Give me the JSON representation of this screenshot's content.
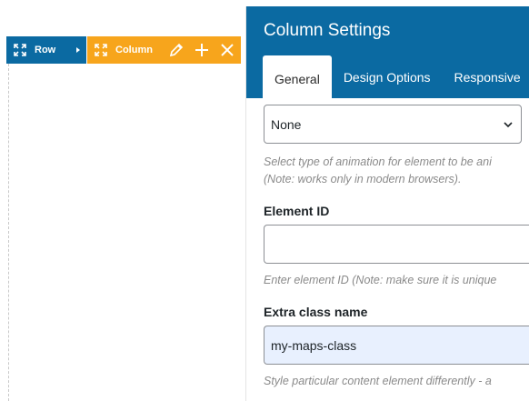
{
  "builder": {
    "row_label": "Row",
    "column_label": "Column"
  },
  "panel": {
    "title": "Column Settings",
    "tabs": [
      "General",
      "Design Options",
      "Responsive"
    ],
    "active_tab": "General",
    "animation": {
      "value": "None",
      "help": "Select type of animation for element to be ani",
      "help_note": "(Note: works only in modern browsers)."
    },
    "element_id": {
      "label": "Element ID",
      "value": "",
      "help": "Enter element ID (Note: make sure it is unique"
    },
    "extra_class": {
      "label": "Extra class name",
      "value": "my-maps-class",
      "help": "Style particular content element differently - a"
    }
  },
  "colors": {
    "primary": "#0b6aa2",
    "column_accent": "#f7a51c",
    "autofill": "#e8f0fe"
  }
}
